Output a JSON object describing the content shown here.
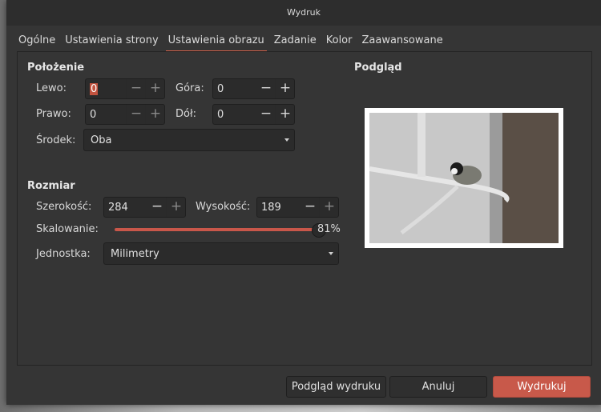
{
  "window": {
    "title": "Wydruk"
  },
  "tabs": [
    "Ogólne",
    "Ustawienia strony",
    "Ustawienia obrazu",
    "Zadanie",
    "Kolor",
    "Zaawansowane"
  ],
  "position": {
    "heading": "Położenie",
    "left_label": "Lewo:",
    "left_value": "0",
    "top_label": "Góra:",
    "top_value": "0",
    "right_label": "Prawo:",
    "right_value": "0",
    "bottom_label": "Dół:",
    "bottom_value": "0",
    "center_label": "Środek:",
    "center_value": "Oba"
  },
  "size": {
    "heading": "Rozmiar",
    "width_label": "Szerokość:",
    "width_value": "284",
    "height_label": "Wysokość:",
    "height_value": "189",
    "scale_label": "Skalowanie:",
    "scale_value": "81%",
    "scale_fraction": 0.81,
    "unit_label": "Jednostka:",
    "unit_value": "Milimetry"
  },
  "preview": {
    "heading": "Podgląd"
  },
  "buttons": {
    "preview": "Podgląd wydruku",
    "cancel": "Anuluj",
    "print": "Wydrukuj"
  },
  "icons": {
    "minus": "−",
    "plus": "+"
  },
  "colors": {
    "accent": "#c8594a"
  }
}
